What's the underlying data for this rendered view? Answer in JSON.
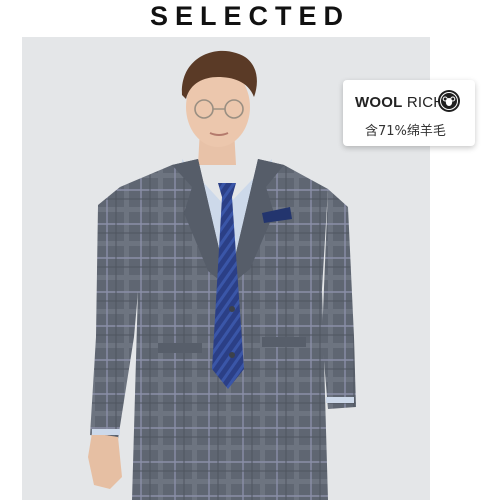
{
  "brand": {
    "name": "SELECTED"
  },
  "product_image": {
    "description_icon": "model-in-plaid-suit"
  },
  "badge": {
    "title_part1": "WOOL",
    "title_part2": " RICH",
    "seal_icon": "ram-head-seal-icon",
    "subtitle": "含71%绵羊毛"
  },
  "colors": {
    "suit": "#5f6672",
    "tie": "#2b3f86",
    "shirt": "#cdd9ea",
    "background": "#e4e6e8"
  }
}
